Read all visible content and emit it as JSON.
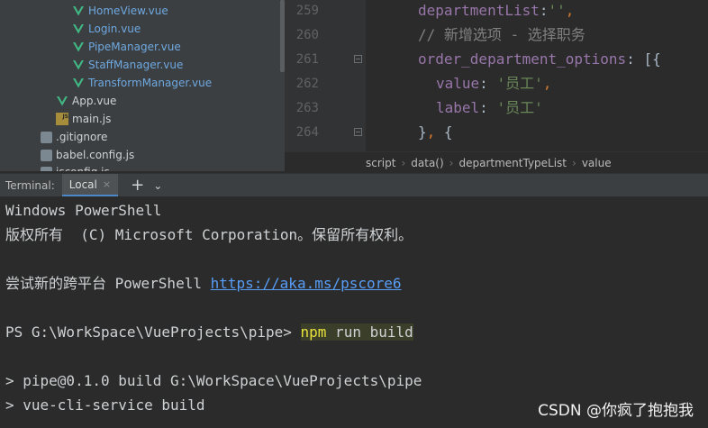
{
  "project_tree": {
    "items": [
      {
        "label": "HomeView.vue",
        "type": "vue"
      },
      {
        "label": "Login.vue",
        "type": "vue"
      },
      {
        "label": "PipeManager.vue",
        "type": "vue"
      },
      {
        "label": "StaffManager.vue",
        "type": "vue"
      },
      {
        "label": "TransformManager.vue",
        "type": "vue"
      },
      {
        "label": "App.vue",
        "type": "vue"
      },
      {
        "label": "main.js",
        "type": "js"
      },
      {
        "label": ".gitignore",
        "type": "config"
      },
      {
        "label": "babel.config.js",
        "type": "config"
      },
      {
        "label": "jsconfig.js",
        "type": "config"
      }
    ]
  },
  "editor": {
    "line_numbers": [
      "259",
      "260",
      "261",
      "262",
      "263",
      "264"
    ],
    "lines": [
      {
        "key": "departmentList",
        "colon": ":",
        "str": "''",
        "tail": ","
      },
      {
        "comment": "// 新增选项 - 选择职务"
      },
      {
        "key": "order_department_options",
        "colon": ": ",
        "tail": "[{"
      },
      {
        "key": "value",
        "colon": ": ",
        "str": "'员工'",
        "tail": ","
      },
      {
        "key": "label",
        "colon": ": ",
        "str": "'员工'"
      },
      {
        "brace": "}",
        "tail": ", ",
        "brace2": "{"
      }
    ],
    "breadcrumb": [
      "script",
      "data()",
      "departmentTypeList",
      "value"
    ]
  },
  "terminal": {
    "title": "Terminal:",
    "tab_label": "Local",
    "close_glyph": "×",
    "add_glyph": "+",
    "menu_glyph": "⌄",
    "lines": {
      "l1": "Windows PowerShell",
      "l2": "版权所有  (C) Microsoft Corporation。保留所有权利。",
      "l3_prefix": "尝试新的跨平台 PowerShell ",
      "l3_link": "https://aka.ms/pscore6",
      "l4_prompt": "PS G:\\WorkSpace\\VueProjects\\pipe> ",
      "l4_npm": "npm",
      "l4_rest": " run build",
      "l5": "> pipe@0.1.0 build G:\\WorkSpace\\VueProjects\\pipe",
      "l6": "> vue-cli-service build"
    }
  },
  "watermark": "CSDN @你疯了抱抱我",
  "colors": {
    "vue_icon": "#41b883",
    "link": "#589df6",
    "npm_highlight": "#e8e23a"
  }
}
